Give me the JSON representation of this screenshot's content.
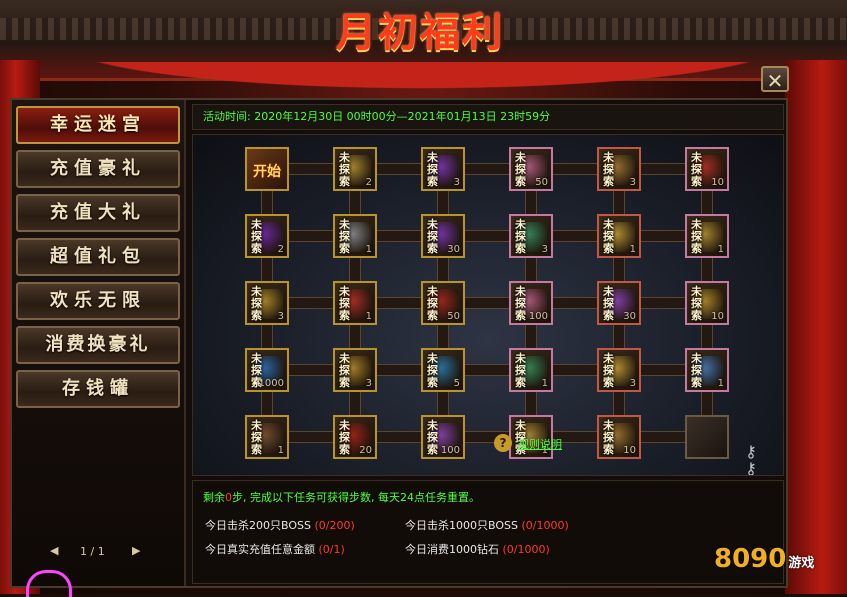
{
  "window": {
    "title": "月初福利",
    "close_glyph": "✕"
  },
  "sidebar": {
    "items": [
      {
        "label": "幸运迷宫",
        "active": true
      },
      {
        "label": "充值豪礼",
        "active": false
      },
      {
        "label": "充值大礼",
        "active": false
      },
      {
        "label": "超值礼包",
        "active": false
      },
      {
        "label": "欢乐无限",
        "active": false
      },
      {
        "label": "消费换豪礼",
        "active": false
      },
      {
        "label": "存钱罐",
        "active": false
      }
    ],
    "pager": {
      "prev": "◀",
      "text": "1 / 1",
      "next": "▶"
    }
  },
  "activity": {
    "time_text": "活动时间: 2020年12月30日 00时00分—2021年01月13日 23时59分"
  },
  "board": {
    "start_label": "开始",
    "unexplored_label": "未探索",
    "rows": [
      [
        {
          "type": "start",
          "count": ""
        },
        {
          "icon": "gold-icon",
          "count": "2"
        },
        {
          "icon": "purple-gem-icon",
          "count": "3"
        },
        {
          "icon": "pink-item-icon",
          "count": "50"
        },
        {
          "icon": "scroll-icon",
          "count": "3"
        },
        {
          "icon": "red-gem-icon",
          "count": "10"
        }
      ],
      [
        {
          "icon": "purple-orb-icon",
          "count": "2"
        },
        {
          "icon": "key-icon",
          "count": "1"
        },
        {
          "icon": "purple-gem-icon",
          "count": "30"
        },
        {
          "icon": "green-gem-icon",
          "count": "3"
        },
        {
          "icon": "gold-key-icon",
          "count": "1"
        },
        {
          "icon": "gold-icon",
          "count": "1"
        }
      ],
      [
        {
          "icon": "gold-pile-icon",
          "count": "3"
        },
        {
          "icon": "red-gem-icon",
          "count": "1"
        },
        {
          "icon": "red-box-icon",
          "count": "50"
        },
        {
          "icon": "pink-item-icon",
          "count": "100"
        },
        {
          "icon": "purple-item-icon",
          "count": "30"
        },
        {
          "icon": "gold-pile-icon",
          "count": "10"
        }
      ],
      [
        {
          "icon": "blue-gem-icon",
          "count": "1000"
        },
        {
          "icon": "gold-item-icon",
          "count": "3"
        },
        {
          "icon": "blue-box-icon",
          "count": "5"
        },
        {
          "icon": "green-box-icon",
          "count": "1"
        },
        {
          "icon": "gold-key-icon",
          "count": "3"
        },
        {
          "icon": "blue-item-icon",
          "count": "1"
        }
      ],
      [
        {
          "icon": "brown-item-icon",
          "count": "1"
        },
        {
          "icon": "red-orb-icon",
          "count": "20"
        },
        {
          "icon": "purple-item-icon",
          "count": "100"
        },
        {
          "icon": "gold-chest-icon",
          "count": "1"
        },
        {
          "icon": "scroll-icon",
          "count": "10"
        },
        {
          "type": "end",
          "count": ""
        }
      ]
    ],
    "colors": {
      "gold": "#b8952c",
      "pink": "#c47aa0",
      "red": "#c0584a"
    }
  },
  "tasks": {
    "summary_prefix": "剩余",
    "summary_steps": "0",
    "summary_suffix": "步, 完成以下任务可获得步数, 每天24点任务重置。",
    "list": [
      {
        "text": "今日击杀200只BOSS",
        "progress": "(0/200)"
      },
      {
        "text": "今日击杀1000只BOSS",
        "progress": "(0/1000)"
      },
      {
        "text": "今日真实充值任意金额",
        "progress": "(0/1)"
      },
      {
        "text": "今日消费1000钻石",
        "progress": "(0/1000)"
      }
    ],
    "help_glyph": "?",
    "help_label": "规则说明"
  },
  "watermark": {
    "brand": "8090",
    "suffix": "游戏"
  }
}
